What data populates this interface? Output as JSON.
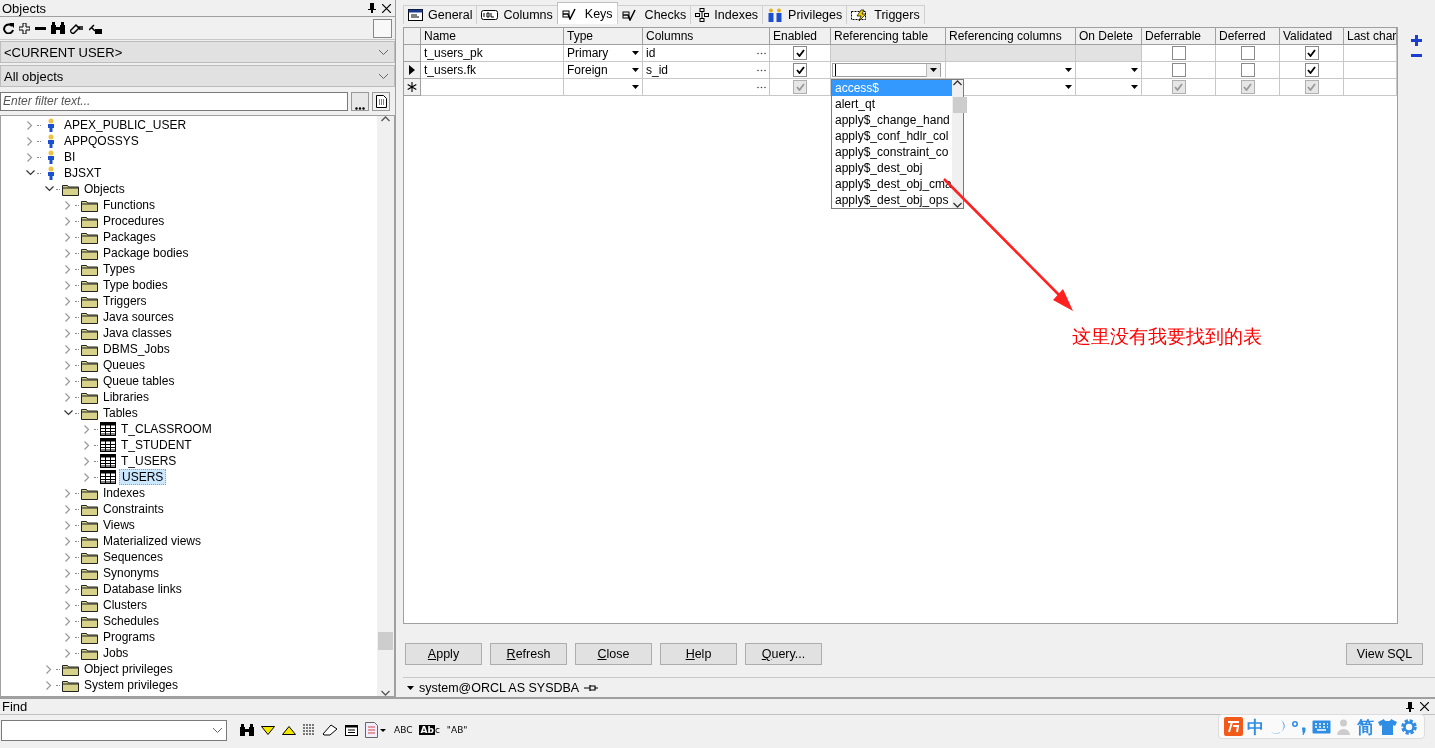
{
  "objects_panel": {
    "title": "Objects",
    "user_combo": "<CURRENT USER>",
    "type_combo": "All objects",
    "filter": {
      "placeholder": "Enter filter text..."
    },
    "tree": [
      {
        "label": "APEX_PUBLIC_USER",
        "kind": "user",
        "expanded": false,
        "selected": false
      },
      {
        "label": "APPQOSSYS",
        "kind": "user",
        "expanded": false,
        "selected": false
      },
      {
        "label": "BI",
        "kind": "user",
        "expanded": false,
        "selected": false
      },
      {
        "label": "BJSXT",
        "kind": "user",
        "expanded": true,
        "selected": false,
        "children": [
          {
            "label": "Objects",
            "kind": "folder",
            "expanded": true,
            "selected": false,
            "children": [
              {
                "label": "Functions",
                "kind": "folder",
                "expanded": false,
                "selected": false
              },
              {
                "label": "Procedures",
                "kind": "folder",
                "expanded": false,
                "selected": false
              },
              {
                "label": "Packages",
                "kind": "folder",
                "expanded": false,
                "selected": false
              },
              {
                "label": "Package bodies",
                "kind": "folder",
                "expanded": false,
                "selected": false
              },
              {
                "label": "Types",
                "kind": "folder",
                "expanded": false,
                "selected": false
              },
              {
                "label": "Type bodies",
                "kind": "folder",
                "expanded": false,
                "selected": false
              },
              {
                "label": "Triggers",
                "kind": "folder",
                "expanded": false,
                "selected": false
              },
              {
                "label": "Java sources",
                "kind": "folder",
                "expanded": false,
                "selected": false
              },
              {
                "label": "Java classes",
                "kind": "folder",
                "expanded": false,
                "selected": false
              },
              {
                "label": "DBMS_Jobs",
                "kind": "folder",
                "expanded": false,
                "selected": false
              },
              {
                "label": "Queues",
                "kind": "folder",
                "expanded": false,
                "selected": false
              },
              {
                "label": "Queue tables",
                "kind": "folder",
                "expanded": false,
                "selected": false
              },
              {
                "label": "Libraries",
                "kind": "folder",
                "expanded": false,
                "selected": false
              },
              {
                "label": "Tables",
                "kind": "folder",
                "expanded": true,
                "selected": false,
                "children": [
                  {
                    "label": "T_CLASSROOM",
                    "kind": "table",
                    "expanded": false,
                    "selected": false
                  },
                  {
                    "label": "T_STUDENT",
                    "kind": "table",
                    "expanded": false,
                    "selected": false
                  },
                  {
                    "label": "T_USERS",
                    "kind": "table",
                    "expanded": false,
                    "selected": false
                  },
                  {
                    "label": "USERS",
                    "kind": "table",
                    "expanded": false,
                    "selected": true
                  }
                ]
              },
              {
                "label": "Indexes",
                "kind": "folder",
                "expanded": false,
                "selected": false
              },
              {
                "label": "Constraints",
                "kind": "folder",
                "expanded": false,
                "selected": false
              },
              {
                "label": "Views",
                "kind": "folder",
                "expanded": false,
                "selected": false
              },
              {
                "label": "Materialized views",
                "kind": "folder",
                "expanded": false,
                "selected": false
              },
              {
                "label": "Sequences",
                "kind": "folder",
                "expanded": false,
                "selected": false
              },
              {
                "label": "Synonyms",
                "kind": "folder",
                "expanded": false,
                "selected": false
              },
              {
                "label": "Database links",
                "kind": "folder",
                "expanded": false,
                "selected": false
              },
              {
                "label": "Clusters",
                "kind": "folder",
                "expanded": false,
                "selected": false
              },
              {
                "label": "Schedules",
                "kind": "folder",
                "expanded": false,
                "selected": false
              },
              {
                "label": "Programs",
                "kind": "folder",
                "expanded": false,
                "selected": false
              },
              {
                "label": "Jobs",
                "kind": "folder",
                "expanded": false,
                "selected": false
              }
            ]
          },
          {
            "label": "Object privileges",
            "kind": "folder",
            "expanded": false,
            "selected": false
          },
          {
            "label": "System privileges",
            "kind": "folder",
            "expanded": false,
            "selected": false
          }
        ]
      }
    ]
  },
  "tabs": [
    {
      "label": "General",
      "kind": "window",
      "selected": false
    },
    {
      "label": "Columns",
      "kind": "col",
      "selected": false
    },
    {
      "label": "Keys",
      "kind": "key",
      "selected": true
    },
    {
      "label": "Checks",
      "kind": "key",
      "selected": false
    },
    {
      "label": "Indexes",
      "kind": "index",
      "selected": false
    },
    {
      "label": "Privileges",
      "kind": "people",
      "selected": false
    },
    {
      "label": "Triggers",
      "kind": "trigger",
      "selected": false
    }
  ],
  "grid": {
    "columns": [
      "Name",
      "Type",
      "Columns",
      "Enabled",
      "Referencing table",
      "Referencing columns",
      "On Delete",
      "Deferrable",
      "Deferred",
      "Validated",
      "Last char"
    ],
    "rows": [
      {
        "kind": "existing",
        "selected": false,
        "name": "t_users_pk",
        "type": "Primary",
        "columns": "id",
        "enabled": {
          "checked": true,
          "disabled": false
        },
        "referencing_table": {
          "disabled": true,
          "editing": false
        },
        "referencing_columns": {
          "disabled": true
        },
        "on_delete": {
          "disabled": true
        },
        "deferrable": {
          "checked": false,
          "disabled": false
        },
        "deferred": {
          "checked": false,
          "disabled": false
        },
        "validated": {
          "checked": true,
          "disabled": false
        }
      },
      {
        "kind": "existing",
        "selected": true,
        "name": "t_users.fk",
        "type": "Foreign",
        "columns": "s_id",
        "enabled": {
          "checked": true,
          "disabled": false
        },
        "referencing_table": {
          "disabled": false,
          "editing": true
        },
        "referencing_columns": {
          "disabled": false
        },
        "on_delete": {
          "disabled": false
        },
        "deferrable": {
          "checked": false,
          "disabled": false
        },
        "deferred": {
          "checked": false,
          "disabled": false
        },
        "validated": {
          "checked": true,
          "disabled": false
        }
      },
      {
        "kind": "new",
        "selected": false,
        "enabled": {
          "checked": true,
          "disabled": true
        },
        "referencing_columns": {
          "disabled": false
        },
        "on_delete": {
          "disabled": false
        },
        "deferrable": {
          "checked": true,
          "disabled": true
        },
        "deferred": {
          "checked": true,
          "disabled": true
        },
        "validated": {
          "checked": true,
          "disabled": true
        }
      }
    ],
    "dropdown": [
      {
        "label": "access$",
        "selected": true
      },
      {
        "label": "alert_qt",
        "selected": false
      },
      {
        "label": "apply$_change_hand",
        "selected": false
      },
      {
        "label": "apply$_conf_hdlr_col",
        "selected": false
      },
      {
        "label": "apply$_constraint_co",
        "selected": false
      },
      {
        "label": "apply$_dest_obj",
        "selected": false
      },
      {
        "label": "apply$_dest_obj_cma",
        "selected": false
      },
      {
        "label": "apply$_dest_obj_ops",
        "selected": false
      }
    ]
  },
  "annotation": {
    "text": "这里没有我要找到的表"
  },
  "buttons": [
    {
      "label": "Apply",
      "mnemonic": true
    },
    {
      "label": "Refresh",
      "mnemonic": true
    },
    {
      "label": "Close",
      "mnemonic": true
    },
    {
      "label": "Help",
      "mnemonic": true
    },
    {
      "label": "Query...",
      "mnemonic": true
    }
  ],
  "view_sql_button": {
    "label": "View SQL",
    "mnemonic": false
  },
  "status": "system@ORCL AS SYSDBA",
  "find_panel": {
    "title": "Find",
    "tools": [
      {
        "kind": "binoculars"
      },
      {
        "kind": "down"
      },
      {
        "kind": "up"
      },
      {
        "kind": "lines"
      },
      {
        "kind": "eraser"
      },
      {
        "kind": "form"
      },
      {
        "kind": "page"
      },
      {
        "kind": "text",
        "label": "ABC"
      },
      {
        "kind": "boxtext",
        "label": "Ab",
        "tail": "c"
      },
      {
        "kind": "text",
        "label": "\"AB\""
      }
    ]
  },
  "ime_bar": [
    {
      "kind": "logo"
    },
    {
      "kind": "text",
      "label": "中"
    },
    {
      "kind": "moon"
    },
    {
      "kind": "punct"
    },
    {
      "kind": "keyboard"
    },
    {
      "kind": "person"
    },
    {
      "kind": "text",
      "label": "简"
    },
    {
      "kind": "shirt"
    },
    {
      "kind": "gear"
    }
  ]
}
